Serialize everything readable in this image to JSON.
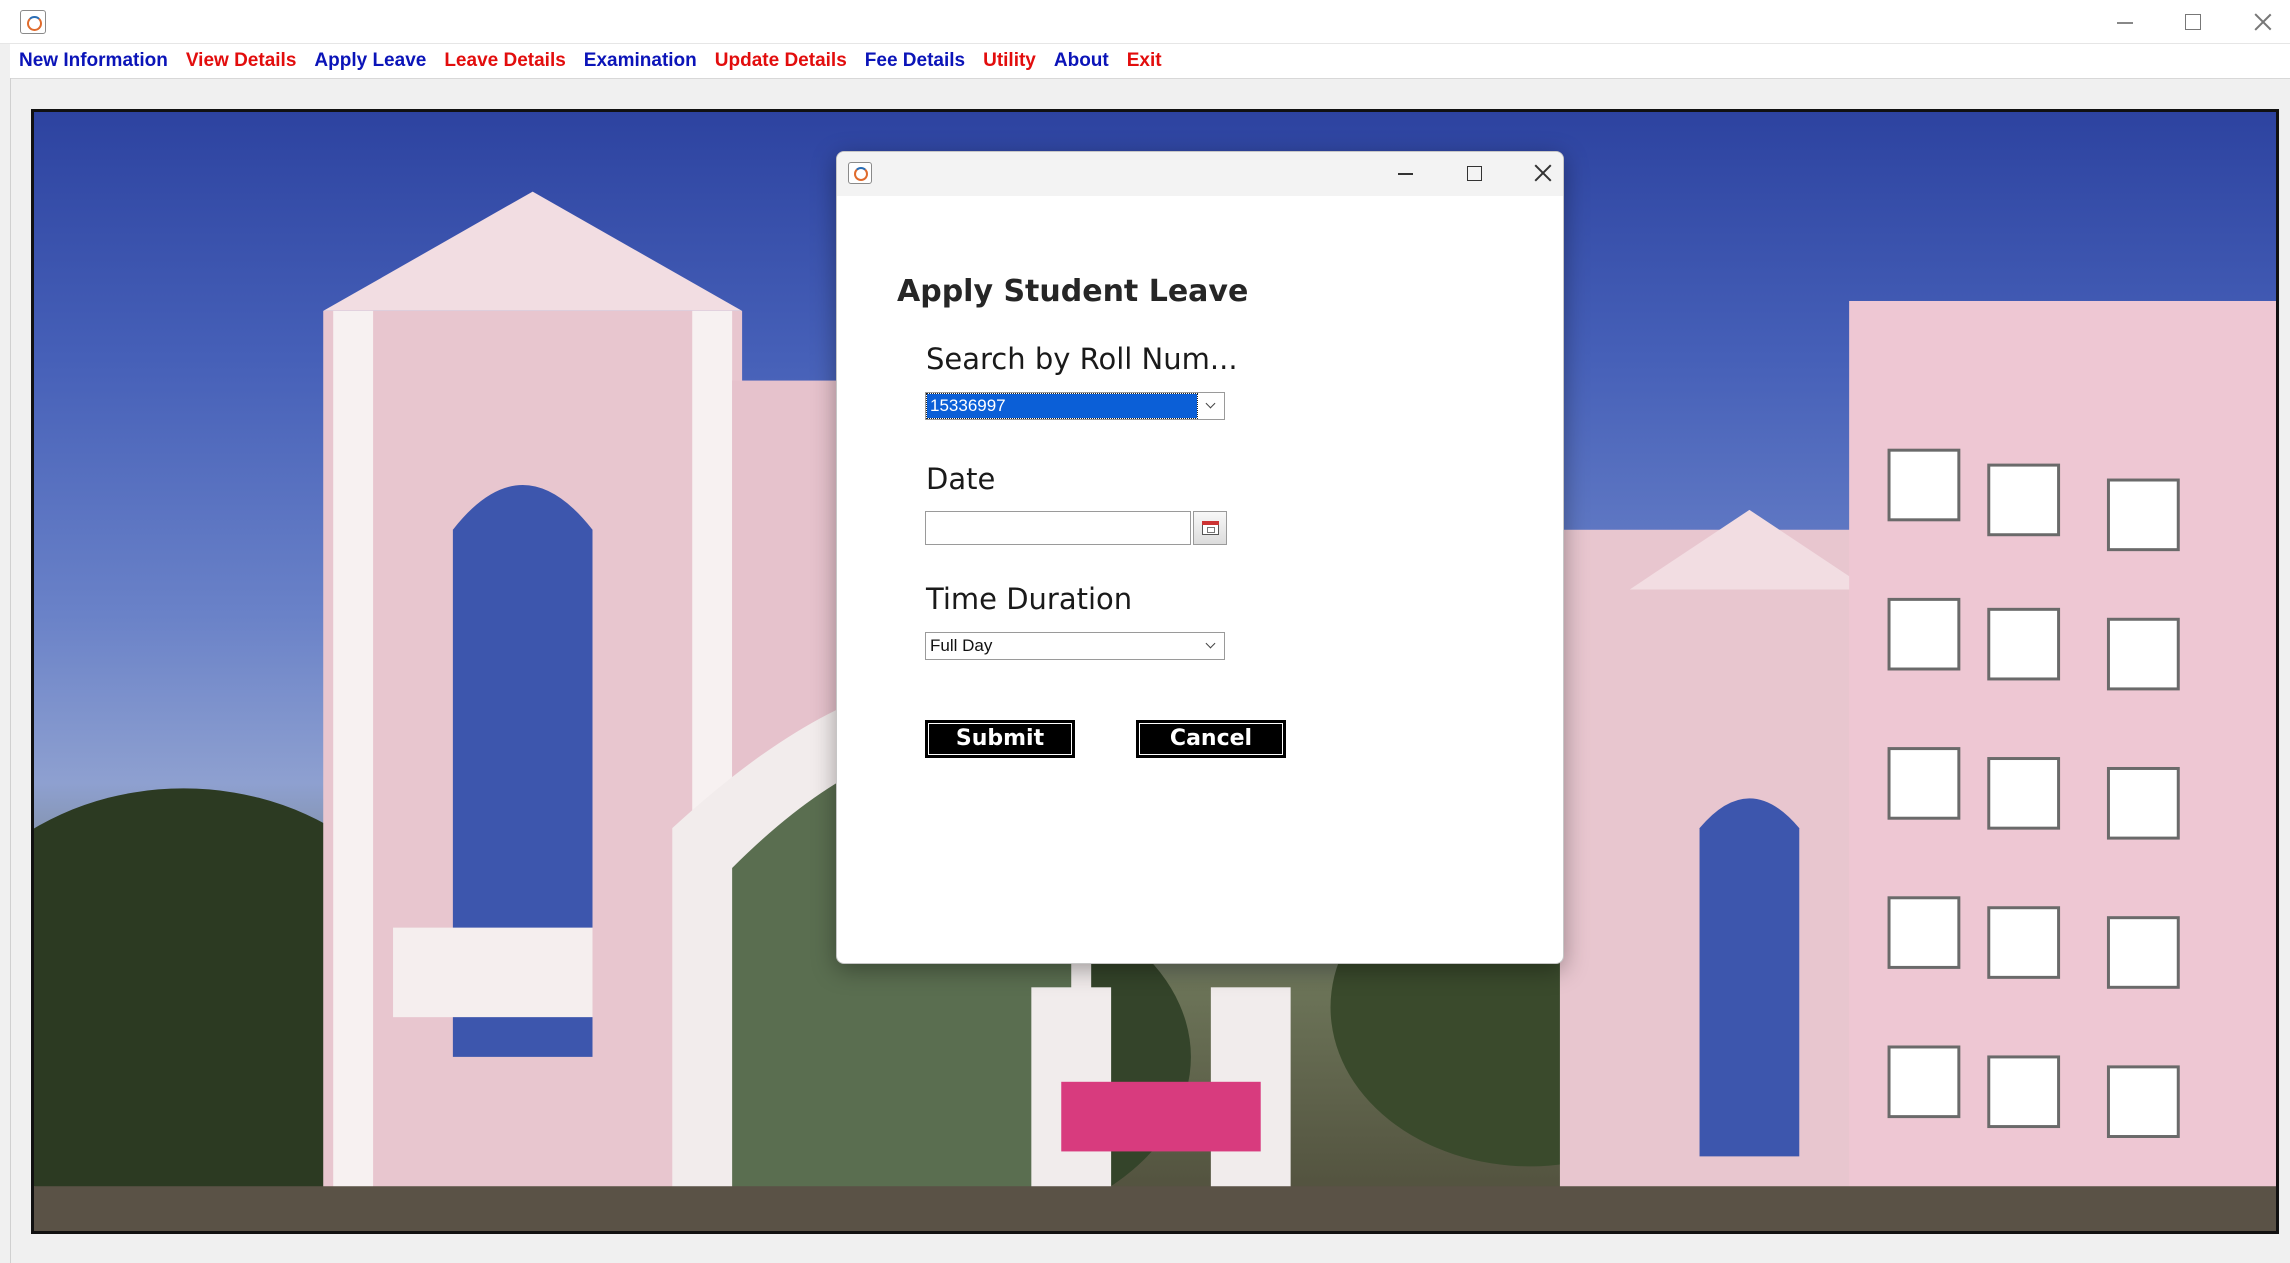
{
  "window": {
    "minimize_label": "–",
    "maximize_label": "☐",
    "close_label": "✕"
  },
  "menu": [
    {
      "label": "New Information",
      "color": "#0b14b8"
    },
    {
      "label": "View Details",
      "color": "#e20d0d"
    },
    {
      "label": "Apply Leave",
      "color": "#0b14b8"
    },
    {
      "label": "Leave Details",
      "color": "#e20d0d"
    },
    {
      "label": "Examination",
      "color": "#0b14b8"
    },
    {
      "label": "Update Details",
      "color": "#e20d0d"
    },
    {
      "label": "Fee Details",
      "color": "#0b14b8"
    },
    {
      "label": "Utility",
      "color": "#e20d0d"
    },
    {
      "label": "About",
      "color": "#0b14b8"
    },
    {
      "label": "Exit",
      "color": "#e20d0d"
    }
  ],
  "dialog": {
    "heading": "Apply Student Leave",
    "roll_label": "Search by Roll Num...",
    "roll_value": "15336997",
    "date_label": "Date",
    "date_value": "",
    "duration_label": "Time Duration",
    "duration_value": "Full Day",
    "submit_label": "Submit",
    "cancel_label": "Cancel"
  },
  "icons": {
    "app": "java-app-icon",
    "calendar": "calendar-icon"
  }
}
